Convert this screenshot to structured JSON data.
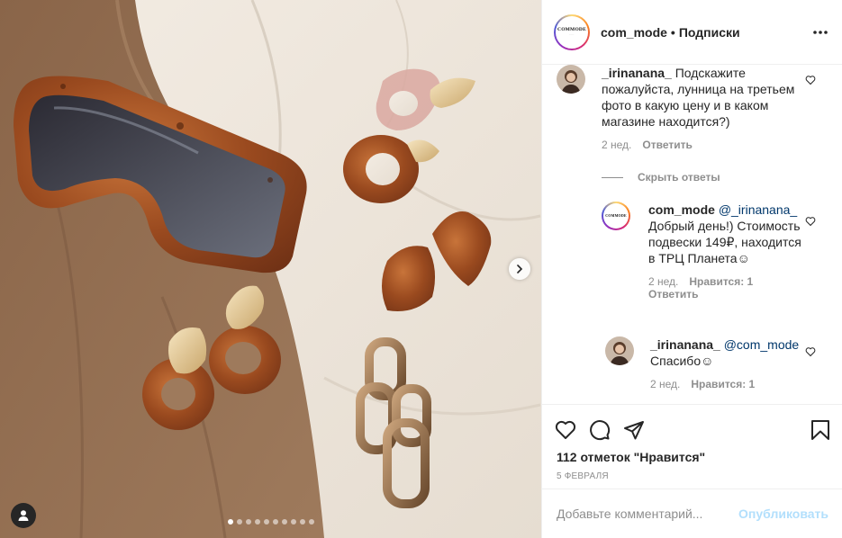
{
  "header": {
    "username": "com_mode",
    "separator": "•",
    "follow_label": "Подписки",
    "avatar_logo": "COMMODE"
  },
  "carousel": {
    "slides": 10,
    "active_index": 0
  },
  "comments": [
    {
      "username": "_irinanana_",
      "text": "Подскажите пожалуйста, лунница на третьем фото в какую цену и в каком магазине находится?)",
      "time": "2 нед.",
      "reply_label": "Ответить"
    }
  ],
  "hide_replies_label": "Скрыть ответы",
  "replies": [
    {
      "username": "com_mode",
      "mention": "@_irinanana_",
      "text": "Добрый день!) Стоимость подвески 149₽, находится в ТРЦ Планета☺",
      "time": "2 нед.",
      "likes_label": "Нравится: 1",
      "reply_label": "Ответить"
    },
    {
      "username": "_irinanana_",
      "mention": "@com_mode",
      "text": "Спасибо☺",
      "time": "2 нед.",
      "likes_label": "Нравится: 1"
    }
  ],
  "likes_text": "112 отметок \"Нравится\"",
  "date_text": "5 февраля",
  "comment_input": {
    "placeholder": "Добавьте комментарий...",
    "value": ""
  },
  "publish_label": "Опубликовать",
  "colors": {
    "text": "#262626",
    "secondary": "#8e8e8e",
    "mention": "#00376b",
    "publish_disabled": "#b2dffc"
  }
}
